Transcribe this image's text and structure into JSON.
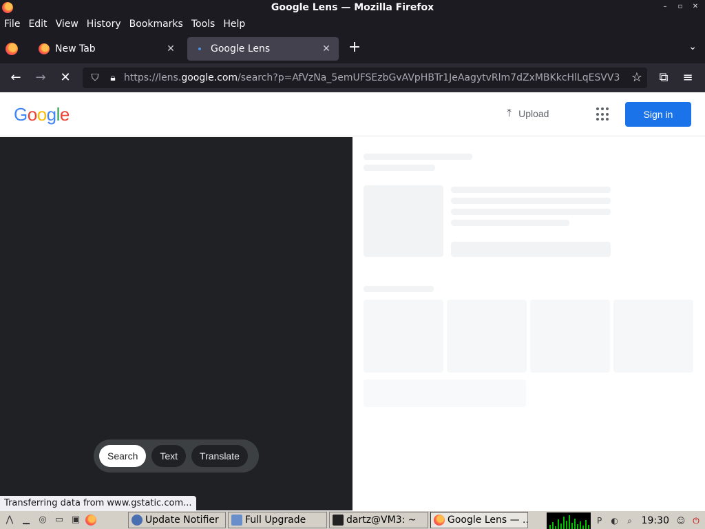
{
  "window": {
    "title": "Google Lens — Mozilla Firefox",
    "controls": [
      "–",
      "▫",
      "✕"
    ]
  },
  "menu": [
    "File",
    "Edit",
    "View",
    "History",
    "Bookmarks",
    "Tools",
    "Help"
  ],
  "tabs": [
    {
      "label": "New Tab",
      "close": "✕"
    },
    {
      "label": "Google Lens",
      "close": "✕"
    }
  ],
  "new_tab_glyph": "+",
  "tab_list_glyph": "⌄",
  "nav": {
    "back": "←",
    "forward": "→",
    "stop": "✕",
    "url_prefix": "https://lens.",
    "url_domain": "google.com",
    "url_rest": "/search?p=AfVzNa_5emUFSEzbGvAVpHBTr1JeAagytvRlm7dZxMBKkcHlLqESVV3",
    "bookmark": "☆",
    "extensions": "⧉",
    "menu": "≡"
  },
  "google": {
    "logo_letters": [
      {
        "ch": "G",
        "cls": "b"
      },
      {
        "ch": "o",
        "cls": "r"
      },
      {
        "ch": "o",
        "cls": "y"
      },
      {
        "ch": "g",
        "cls": "b"
      },
      {
        "ch": "l",
        "cls": "g"
      },
      {
        "ch": "e",
        "cls": "r"
      }
    ],
    "upload_label": "Upload",
    "signin_label": "Sign in"
  },
  "modes": [
    "Search",
    "Text",
    "Translate"
  ],
  "status_text": "Transferring data from www.gstatic.com...",
  "taskbar": {
    "tasks": [
      "Update Notifier",
      "Full Upgrade",
      "dartz@VM3: ~",
      "Google Lens — ..."
    ],
    "clock": "19:30"
  },
  "colors": {
    "accent": "#1a73e8",
    "image_panel": "#202124",
    "skeleton": "#f1f3f4"
  }
}
